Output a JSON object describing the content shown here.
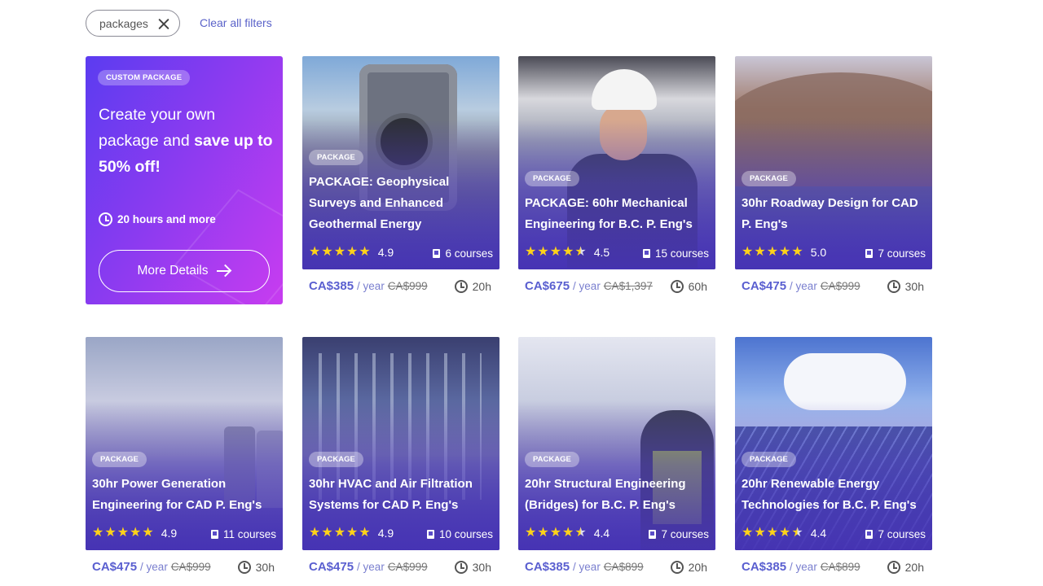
{
  "filters": {
    "chip_label": "packages",
    "clear_label": "Clear all filters"
  },
  "promo": {
    "badge": "CUSTOM PACKAGE",
    "headline_1": "Create your own package and ",
    "headline_bold": "save up to 50% off!",
    "hours": "20 hours and more",
    "button": "More Details"
  },
  "colors": {
    "accent": "#5a5fd0",
    "star": "#ffd21a",
    "promo_gradient_start": "#5b3cf0",
    "promo_gradient_end": "#c83cf0"
  },
  "cards": [
    {
      "badge": "PACKAGE",
      "title": "PACKAGE: Geophysical Surveys and Enhanced Geothermal Energy",
      "rating": "4.9",
      "stars": 5,
      "courses": "6 courses",
      "price": "CA$385",
      "per": "/ year",
      "old_price": "CA$999",
      "duration": "20h",
      "image_icon": "surveying-instrument"
    },
    {
      "badge": "PACKAGE",
      "title": "PACKAGE: 60hr Mechanical Engineering for B.C. P. Eng's",
      "rating": "4.5",
      "stars": 4.5,
      "courses": "15 courses",
      "price": "CA$675",
      "per": "/ year",
      "old_price": "CA$1,397",
      "duration": "60h",
      "image_icon": "engineer-in-hardhat"
    },
    {
      "badge": "PACKAGE",
      "title": "30hr Roadway Design for CAD P. Eng's",
      "rating": "5.0",
      "stars": 5,
      "courses": "7 courses",
      "price": "CA$475",
      "per": "/ year",
      "old_price": "CA$999",
      "duration": "30h",
      "image_icon": "landscape-road"
    },
    {
      "badge": "PACKAGE",
      "title": "30hr Power Generation Engineering for CAD P. Eng's",
      "rating": "4.9",
      "stars": 5,
      "courses": "11 courses",
      "price": "CA$475",
      "per": "/ year",
      "old_price": "CA$999",
      "duration": "30h",
      "image_icon": "cooling-towers"
    },
    {
      "badge": "PACKAGE",
      "title": "30hr HVAC and Air Filtration Systems for CAD P. Eng's",
      "rating": "4.9",
      "stars": 5,
      "courses": "10 courses",
      "price": "CA$475",
      "per": "/ year",
      "old_price": "CA$999",
      "duration": "30h",
      "image_icon": "industrial-pipes"
    },
    {
      "badge": "PACKAGE",
      "title": "20hr Structural Engineering (Bridges) for B.C. P. Eng's",
      "rating": "4.4",
      "stars": 4.5,
      "courses": "7 courses",
      "price": "CA$385",
      "per": "/ year",
      "old_price": "CA$899",
      "duration": "20h",
      "image_icon": "construction-worker"
    },
    {
      "badge": "PACKAGE",
      "title": "20hr Renewable Energy Technologies for B.C. P. Eng's",
      "rating": "4.4",
      "stars": 4.5,
      "courses": "7 courses",
      "price": "CA$385",
      "per": "/ year",
      "old_price": "CA$899",
      "duration": "20h",
      "image_icon": "solar-panels"
    }
  ]
}
